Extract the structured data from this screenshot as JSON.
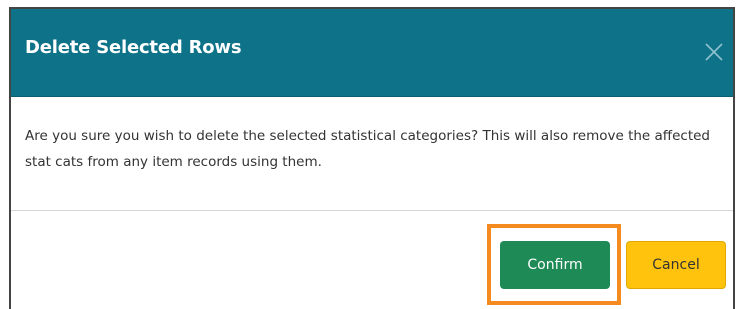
{
  "dialog": {
    "title": "Delete Selected Rows",
    "close_icon": "close-icon",
    "message": "Are you sure you wish to delete the selected statistical categories? This will also remove the affected stat cats from any item records using them.",
    "confirm_label": "Confirm",
    "cancel_label": "Cancel"
  },
  "colors": {
    "header_bg": "#0e7388",
    "confirm_bg": "#1e8a56",
    "cancel_bg": "#ffc20d",
    "highlight": "#f58b1f"
  }
}
